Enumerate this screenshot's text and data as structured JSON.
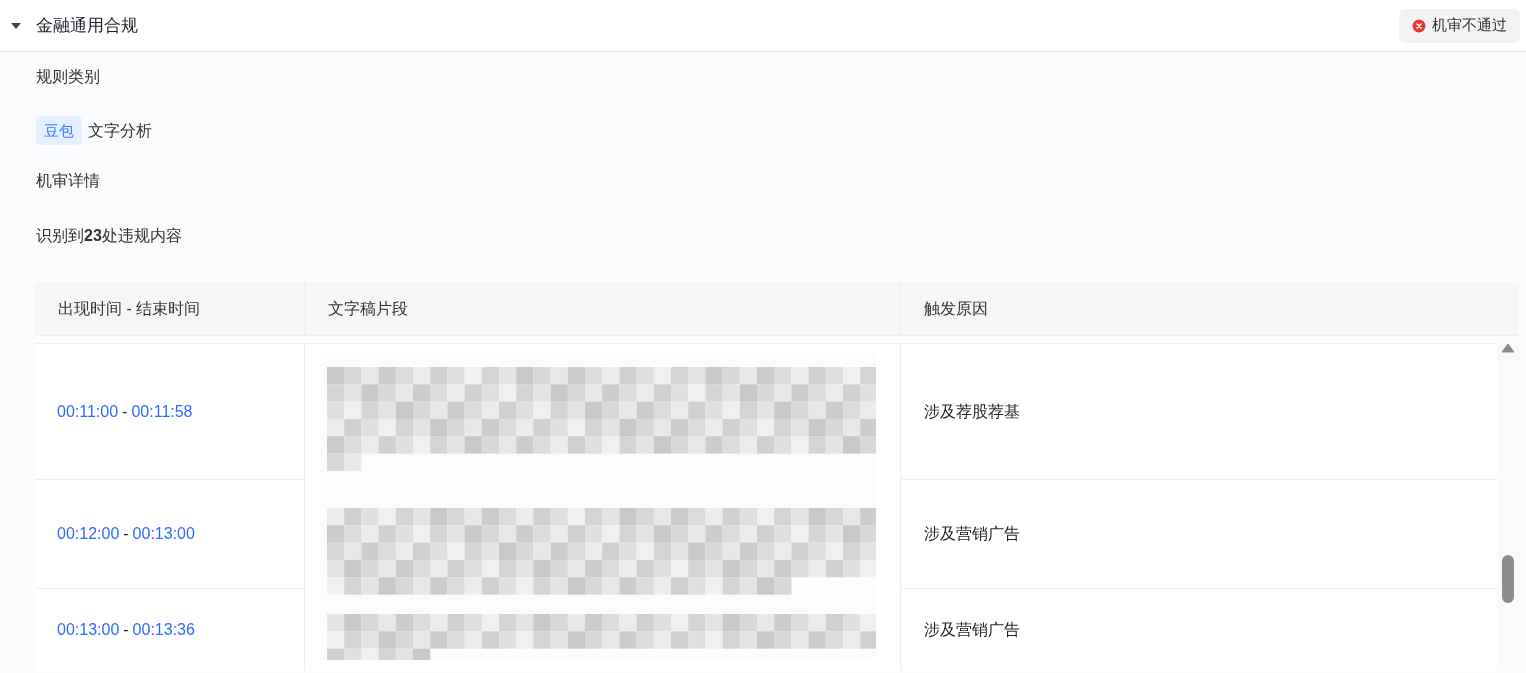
{
  "panel": {
    "title": "金融通用合规",
    "expanded": true,
    "status": {
      "label": "机审不通过",
      "kind": "rejected"
    }
  },
  "sections": [
    {
      "kind": "heading",
      "text": "规则类别"
    },
    {
      "kind": "tagged",
      "tag": "豆包",
      "text": "文字分析"
    },
    {
      "kind": "heading",
      "text": "机审详情"
    },
    {
      "kind": "summary",
      "text": "识别到**23**处违规内容"
    }
  ],
  "table": {
    "columns": [
      "出现时间 - 结束时间",
      "文字稿片段",
      "触发原因"
    ],
    "rows": [
      {
        "start": "00:11:00",
        "separator": "-",
        "end": "00:11:58",
        "reason": "涉及荐股荐基"
      },
      {
        "start": "00:12:00",
        "separator": "-",
        "end": "00:13:00",
        "reason": "涉及营销广告"
      },
      {
        "start": "00:13:00",
        "separator": "-",
        "end": "00:13:36",
        "reason": "涉及营销广告"
      }
    ]
  }
}
